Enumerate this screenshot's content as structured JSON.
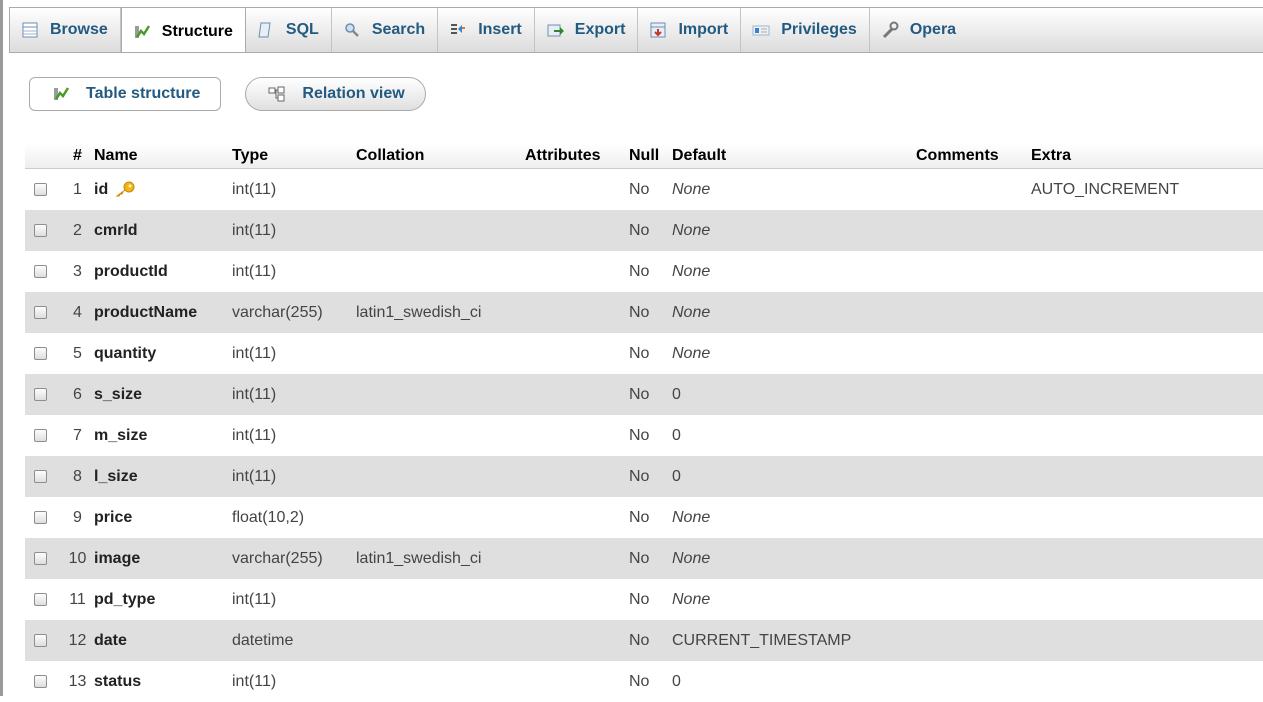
{
  "tabs": [
    {
      "label": "Browse",
      "icon": "browse-icon",
      "active": false
    },
    {
      "label": "Structure",
      "icon": "structure-icon",
      "active": true
    },
    {
      "label": "SQL",
      "icon": "sql-icon",
      "active": false
    },
    {
      "label": "Search",
      "icon": "search-icon",
      "active": false
    },
    {
      "label": "Insert",
      "icon": "insert-icon",
      "active": false
    },
    {
      "label": "Export",
      "icon": "export-icon",
      "active": false
    },
    {
      "label": "Import",
      "icon": "import-icon",
      "active": false
    },
    {
      "label": "Privileges",
      "icon": "privileges-icon",
      "active": false
    },
    {
      "label": "Opera",
      "icon": "operations-icon",
      "active": false
    }
  ],
  "subtabs": {
    "table_structure": "Table structure",
    "relation_view": "Relation view"
  },
  "table": {
    "headers": {
      "num": "#",
      "name": "Name",
      "type": "Type",
      "collation": "Collation",
      "attributes": "Attributes",
      "null": "Null",
      "default": "Default",
      "comments": "Comments",
      "extra": "Extra"
    },
    "rows": [
      {
        "num": "1",
        "name": "id",
        "primary_key": true,
        "type": "int(11)",
        "collation": "",
        "attributes": "",
        "null": "No",
        "default": "None",
        "default_italic": true,
        "comments": "",
        "extra": "AUTO_INCREMENT"
      },
      {
        "num": "2",
        "name": "cmrId",
        "primary_key": false,
        "type": "int(11)",
        "collation": "",
        "attributes": "",
        "null": "No",
        "default": "None",
        "default_italic": true,
        "comments": "",
        "extra": ""
      },
      {
        "num": "3",
        "name": "productId",
        "primary_key": false,
        "type": "int(11)",
        "collation": "",
        "attributes": "",
        "null": "No",
        "default": "None",
        "default_italic": true,
        "comments": "",
        "extra": ""
      },
      {
        "num": "4",
        "name": "productName",
        "primary_key": false,
        "type": "varchar(255)",
        "collation": "latin1_swedish_ci",
        "attributes": "",
        "null": "No",
        "default": "None",
        "default_italic": true,
        "comments": "",
        "extra": ""
      },
      {
        "num": "5",
        "name": "quantity",
        "primary_key": false,
        "type": "int(11)",
        "collation": "",
        "attributes": "",
        "null": "No",
        "default": "None",
        "default_italic": true,
        "comments": "",
        "extra": ""
      },
      {
        "num": "6",
        "name": "s_size",
        "primary_key": false,
        "type": "int(11)",
        "collation": "",
        "attributes": "",
        "null": "No",
        "default": "0",
        "default_italic": false,
        "comments": "",
        "extra": ""
      },
      {
        "num": "7",
        "name": "m_size",
        "primary_key": false,
        "type": "int(11)",
        "collation": "",
        "attributes": "",
        "null": "No",
        "default": "0",
        "default_italic": false,
        "comments": "",
        "extra": ""
      },
      {
        "num": "8",
        "name": "l_size",
        "primary_key": false,
        "type": "int(11)",
        "collation": "",
        "attributes": "",
        "null": "No",
        "default": "0",
        "default_italic": false,
        "comments": "",
        "extra": ""
      },
      {
        "num": "9",
        "name": "price",
        "primary_key": false,
        "type": "float(10,2)",
        "collation": "",
        "attributes": "",
        "null": "No",
        "default": "None",
        "default_italic": true,
        "comments": "",
        "extra": ""
      },
      {
        "num": "10",
        "name": "image",
        "primary_key": false,
        "type": "varchar(255)",
        "collation": "latin1_swedish_ci",
        "attributes": "",
        "null": "No",
        "default": "None",
        "default_italic": true,
        "comments": "",
        "extra": ""
      },
      {
        "num": "11",
        "name": "pd_type",
        "primary_key": false,
        "type": "int(11)",
        "collation": "",
        "attributes": "",
        "null": "No",
        "default": "None",
        "default_italic": true,
        "comments": "",
        "extra": ""
      },
      {
        "num": "12",
        "name": "date",
        "primary_key": false,
        "type": "datetime",
        "collation": "",
        "attributes": "",
        "null": "No",
        "default": "CURRENT_TIMESTAMP",
        "default_italic": false,
        "comments": "",
        "extra": ""
      },
      {
        "num": "13",
        "name": "status",
        "primary_key": false,
        "type": "int(11)",
        "collation": "",
        "attributes": "",
        "null": "No",
        "default": "0",
        "default_italic": false,
        "comments": "",
        "extra": ""
      }
    ]
  },
  "colors": {
    "link": "#235a81",
    "row_alt": "#dfdfdf"
  }
}
